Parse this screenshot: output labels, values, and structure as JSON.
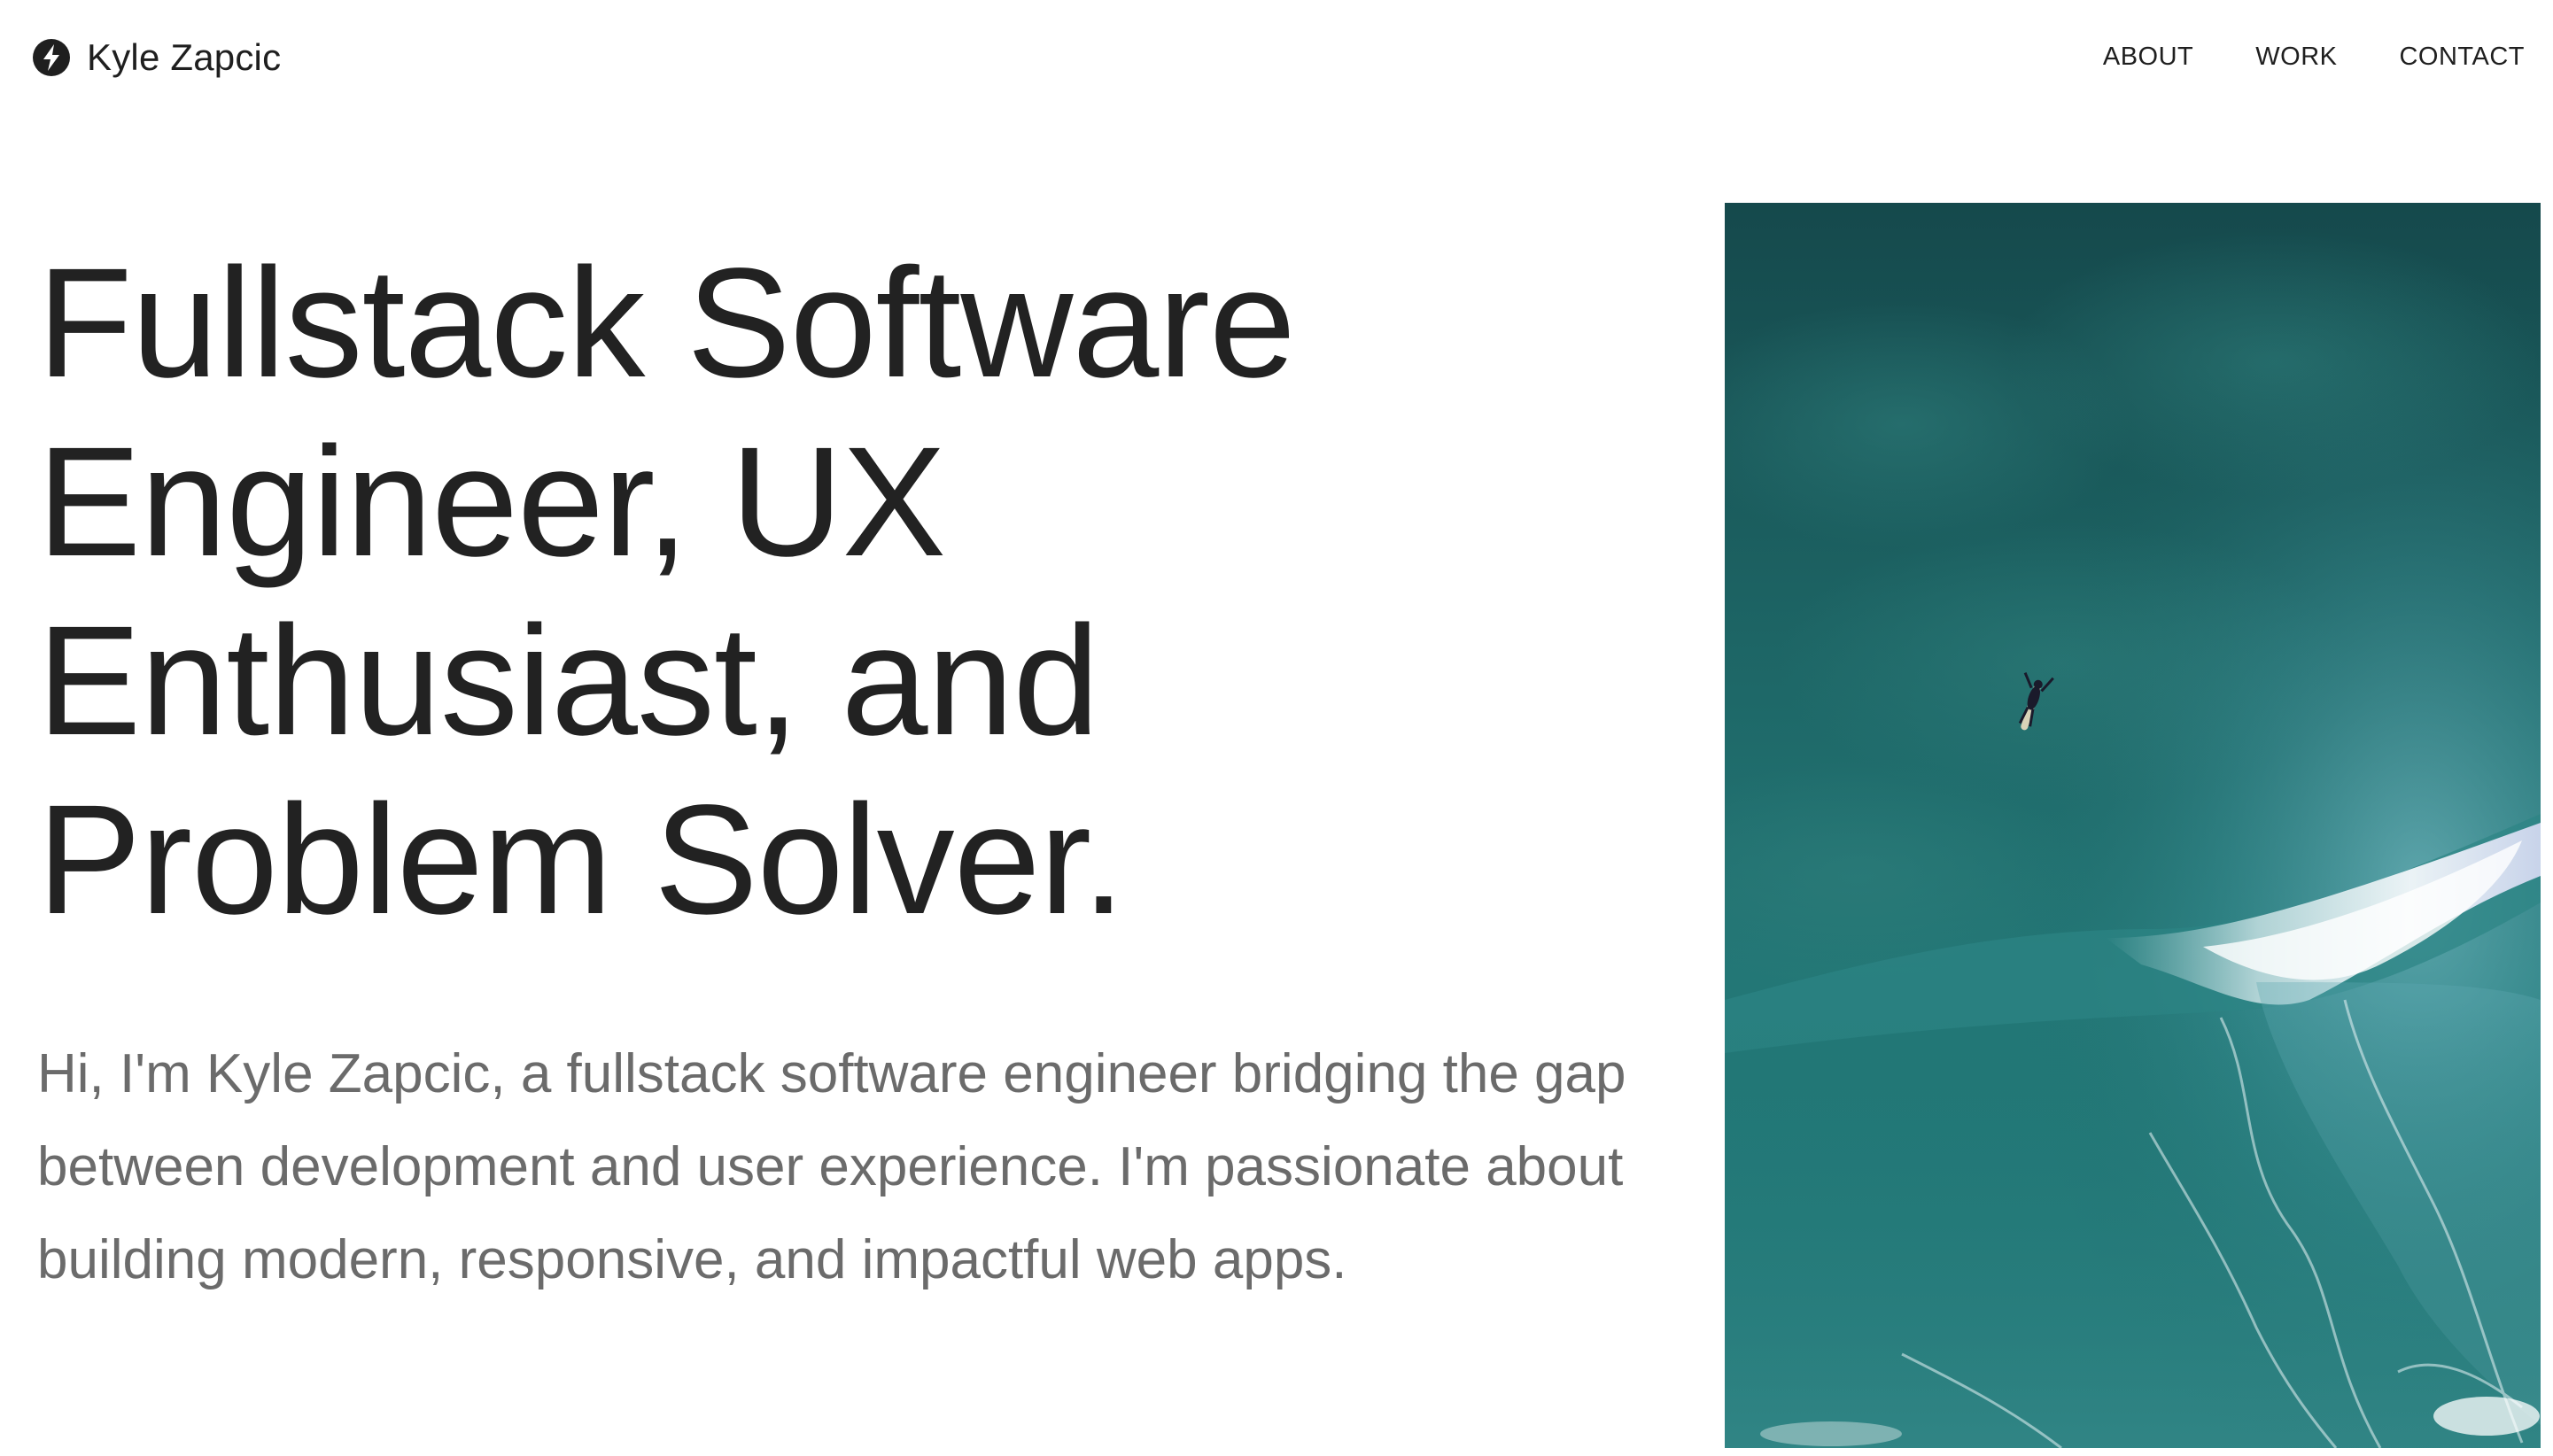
{
  "header": {
    "brand_icon": "lightning-bolt-icon",
    "brand_name": "Kyle Zapcic",
    "nav": [
      {
        "label": "ABOUT"
      },
      {
        "label": "WORK"
      },
      {
        "label": "CONTACT"
      }
    ]
  },
  "hero": {
    "title_lines": [
      "Fullstack Software",
      "Engineer, UX",
      "Enthusiast, and",
      "Problem Solver."
    ],
    "intro": "Hi, I'm Kyle Zapcic, a fullstack software engineer bridging the gap between development and user experience. I'm passionate about building modern, responsive, and impactful web apps."
  },
  "colors": {
    "text": "#222222",
    "muted_text": "#6b6b6b",
    "ocean_deep": "#12484b",
    "ocean_mid": "#1f6f6e",
    "foam": "#e8f2f6"
  }
}
